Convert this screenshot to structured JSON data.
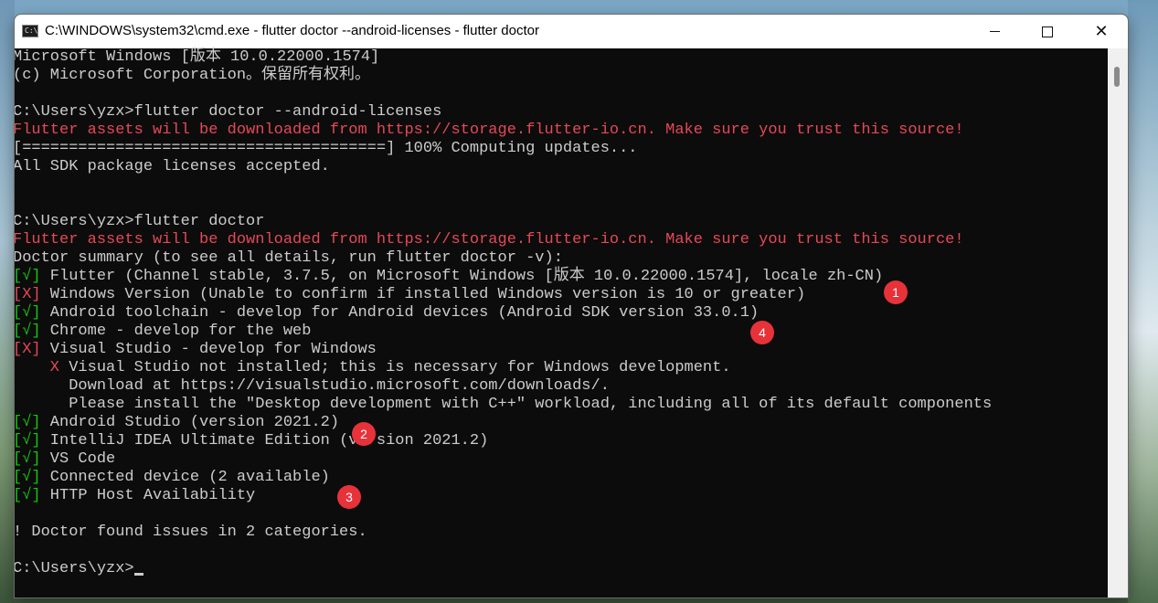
{
  "window": {
    "title": "C:\\WINDOWS\\system32\\cmd.exe - flutter  doctor --android-licenses - flutter  doctor",
    "icon_text": "C:\\",
    "buttons": {
      "minimize": "minimize-icon",
      "maximize": "maximize-icon",
      "close": "close-icon"
    }
  },
  "colors": {
    "console_bg": "#0c0c0c",
    "text": "#cccccc",
    "error": "#e74856",
    "ok": "#16c60c",
    "marker": "#e8323a"
  },
  "console": {
    "lines": [
      "Microsoft Windows [版本 10.0.22000.1574]",
      "(c) Microsoft Corporation。保留所有权利。",
      "",
      "C:\\Users\\yzx>flutter doctor --android-licenses",
      "Flutter assets will be downloaded from https://storage.flutter-io.cn. Make sure you trust this source!",
      "[=======================================] 100% Computing updates...",
      "All SDK package licenses accepted.",
      "",
      "",
      "C:\\Users\\yzx>flutter doctor",
      "Flutter assets will be downloaded from https://storage.flutter-io.cn. Make sure you trust this source!",
      "Doctor summary (to see all details, run flutter doctor -v):"
    ],
    "checks": [
      {
        "mark": "[√]",
        "status": "ok",
        "text": " Flutter (Channel stable, 3.7.5, on Microsoft Windows [版本 10.0.22000.1574], locale zh-CN)"
      },
      {
        "mark": "[X]",
        "status": "error",
        "text": " Windows Version (Unable to confirm if installed Windows version is 10 or greater)"
      },
      {
        "mark": "[√]",
        "status": "ok",
        "text": " Android toolchain - develop for Android devices (Android SDK version 33.0.1)"
      },
      {
        "mark": "[√]",
        "status": "ok",
        "text": " Chrome - develop for the web"
      },
      {
        "mark": "[X]",
        "status": "error",
        "text": " Visual Studio - develop for Windows"
      }
    ],
    "vs_detail": {
      "x_mark": "    X",
      "x_text": " Visual Studio not installed; this is necessary for Windows development.",
      "download": "      Download at https://visualstudio.microsoft.com/downloads/.",
      "install": "      Please install the \"Desktop development with C++\" workload, including all of its default components"
    },
    "checks2": [
      {
        "mark": "[√]",
        "status": "ok",
        "text": " Android Studio (version 2021.2)"
      },
      {
        "mark": "[√]",
        "status": "ok",
        "text": " IntelliJ IDEA Ultimate Edition (version 2021.2)"
      },
      {
        "mark": "[√]",
        "status": "ok",
        "text": " VS Code"
      },
      {
        "mark": "[√]",
        "status": "ok",
        "text": " Connected device (2 available)"
      },
      {
        "mark": "[√]",
        "status": "ok",
        "text": " HTTP Host Availability"
      }
    ],
    "summary": "! Doctor found issues in 2 categories.",
    "prompt": "C:\\Users\\yzx>"
  },
  "markers": [
    "1",
    "4",
    "2",
    "3"
  ]
}
